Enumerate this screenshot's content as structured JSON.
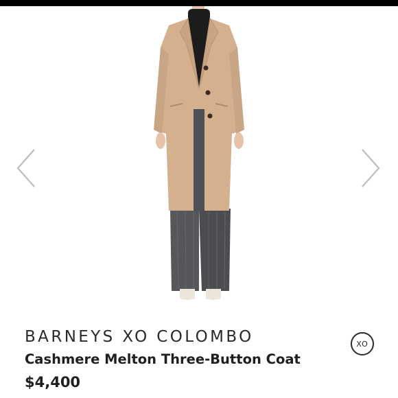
{
  "listing": {
    "brand": "BARNEYS XO COLOMBO",
    "title": "Cashmere Melton Three-Button Coat",
    "price": "$4,400",
    "badge": "XO"
  },
  "carousel": {
    "prev_icon": "chevron-left-icon",
    "next_icon": "chevron-right-icon"
  },
  "colors": {
    "coat": "#d4b08f",
    "trousers": "#505256",
    "turtleneck": "#1c1c1c",
    "arrow": "#bdbdbd"
  }
}
